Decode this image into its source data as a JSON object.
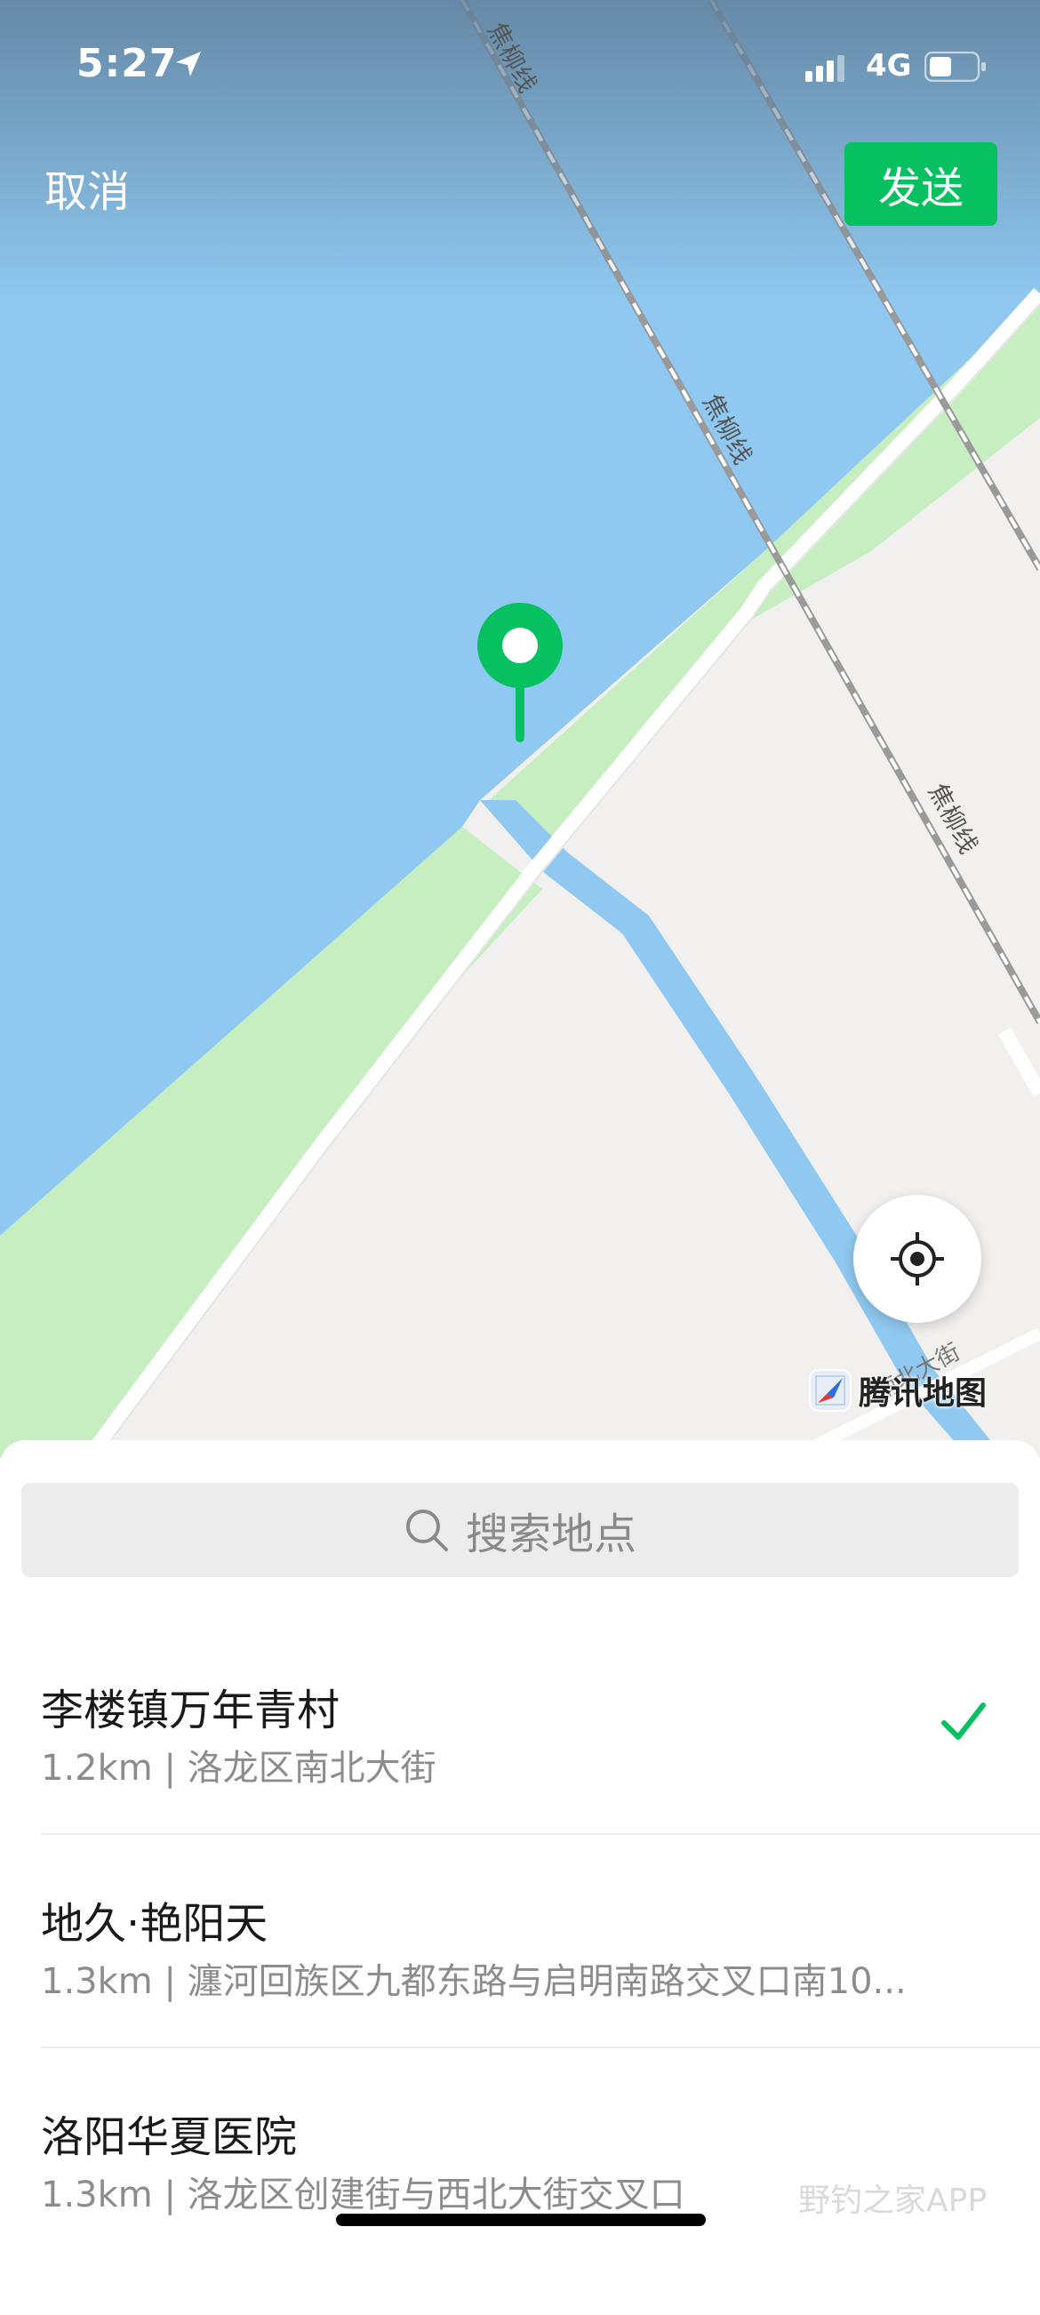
{
  "status_bar": {
    "time": "5:27",
    "network": "4G"
  },
  "nav": {
    "cancel_label": "取消",
    "send_label": "发送"
  },
  "map": {
    "rail_labels": [
      "焦柳线",
      "焦柳线",
      "焦柳线"
    ],
    "street_label": "南北大街",
    "brand": "腾讯地图",
    "colors": {
      "water": "#8FC8F0",
      "grass": "#C6EEC0",
      "land": "#F1F0EE",
      "accent": "#07C160"
    }
  },
  "search": {
    "placeholder": "搜索地点"
  },
  "results": [
    {
      "title": "李楼镇万年青村",
      "subtitle": "1.2km | 洛龙区南北大街",
      "selected": true
    },
    {
      "title": "地久·艳阳天",
      "subtitle": "1.3km | 瀍河回族区九都东路与启明南路交叉口南10...",
      "selected": false
    },
    {
      "title": "洛阳华夏医院",
      "subtitle": "1.3km | 洛龙区创建街与西北大街交叉口",
      "selected": false
    }
  ],
  "watermark": "野钓之家APP"
}
